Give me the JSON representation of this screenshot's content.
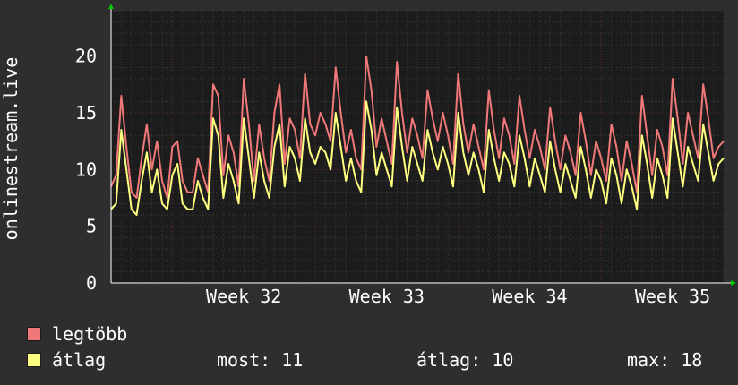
{
  "chart_data": {
    "type": "line",
    "ylabel": "onlinestream.live",
    "ylim": [
      0,
      24
    ],
    "yticks": [
      0,
      5,
      10,
      15,
      20
    ],
    "grid": true,
    "background": "#1c1c1c",
    "grid_major_color": "#5a2a2a",
    "grid_minor_color": "#3a3a3a",
    "axis_color": "#ffffff",
    "arrow_color": "#00c800",
    "x_week_labels": [
      "Week 32",
      "Week 33",
      "Week 34",
      "Week 35"
    ],
    "x": [
      0.0,
      0.25,
      0.5,
      0.75,
      1.0,
      1.25,
      1.5,
      1.75,
      2.0,
      2.25,
      2.5,
      2.75,
      3.0,
      3.25,
      3.5,
      3.75,
      4.0,
      4.25,
      4.5,
      4.75,
      5.0,
      5.25,
      5.5,
      5.75,
      6.0,
      6.25,
      6.5,
      6.75,
      7.0,
      7.25,
      7.5,
      7.75,
      8.0,
      8.25,
      8.5,
      8.75,
      9.0,
      9.25,
      9.5,
      9.75,
      10.0,
      10.25,
      10.5,
      10.75,
      11.0,
      11.25,
      11.5,
      11.75,
      12.0,
      12.25,
      12.5,
      12.75,
      13.0,
      13.25,
      13.5,
      13.75,
      14.0,
      14.25,
      14.5,
      14.75,
      15.0,
      15.25,
      15.5,
      15.75,
      16.0,
      16.25,
      16.5,
      16.75,
      17.0,
      17.25,
      17.5,
      17.75,
      18.0,
      18.25,
      18.5,
      18.75,
      19.0,
      19.25,
      19.5,
      19.75,
      20.0,
      20.25,
      20.5,
      20.75,
      21.0,
      21.25,
      21.5,
      21.75,
      22.0,
      22.25,
      22.5,
      22.75,
      23.0,
      23.25,
      23.5,
      23.75,
      24.0,
      24.25,
      24.5,
      24.75,
      25.0,
      25.25,
      25.5,
      25.75,
      26.0,
      26.25,
      26.5,
      26.75,
      27.0,
      27.25,
      27.5,
      27.75,
      28.0,
      28.25,
      28.5,
      28.75,
      29.0,
      29.25,
      29.5,
      29.75,
      30.0
    ],
    "series": [
      {
        "name": "legtöbb",
        "color": "#f07878",
        "values": [
          8.5,
          9.5,
          16.5,
          12.0,
          8.0,
          7.5,
          11.0,
          14.0,
          10.0,
          12.5,
          9.0,
          7.5,
          12.0,
          12.5,
          9.0,
          8.0,
          8.0,
          11.0,
          9.5,
          8.0,
          17.5,
          16.5,
          9.5,
          13.0,
          11.5,
          8.5,
          18.0,
          14.0,
          9.0,
          14.0,
          11.0,
          9.0,
          15.0,
          17.5,
          10.5,
          14.5,
          13.5,
          11.0,
          18.5,
          14.0,
          13.0,
          15.0,
          14.0,
          12.5,
          19.0,
          15.0,
          11.5,
          13.5,
          11.0,
          10.0,
          20.0,
          17.0,
          12.0,
          14.5,
          12.5,
          10.5,
          19.5,
          15.0,
          11.5,
          14.5,
          13.0,
          11.0,
          17.0,
          14.5,
          12.5,
          15.0,
          13.0,
          10.5,
          18.5,
          14.0,
          11.5,
          14.0,
          12.0,
          10.0,
          17.0,
          13.5,
          11.0,
          14.5,
          13.0,
          10.5,
          16.5,
          13.5,
          11.0,
          13.5,
          12.0,
          10.0,
          15.5,
          12.5,
          10.0,
          13.0,
          11.5,
          9.5,
          15.0,
          12.5,
          9.5,
          12.5,
          11.0,
          9.0,
          14.0,
          12.0,
          9.0,
          12.5,
          10.5,
          8.0,
          16.5,
          13.0,
          9.5,
          13.5,
          12.0,
          9.5,
          18.0,
          14.5,
          10.5,
          15.0,
          13.0,
          11.0,
          17.5,
          14.5,
          11.0,
          12.0,
          12.5
        ]
      },
      {
        "name": "átlag",
        "color": "#ffff80",
        "values": [
          6.5,
          7.0,
          13.5,
          10.0,
          6.5,
          6.0,
          9.0,
          11.5,
          8.0,
          10.0,
          7.0,
          6.5,
          9.5,
          10.5,
          7.0,
          6.5,
          6.5,
          9.0,
          7.5,
          6.5,
          14.5,
          13.0,
          7.5,
          10.5,
          9.0,
          7.0,
          14.5,
          11.0,
          7.5,
          11.5,
          9.0,
          7.5,
          12.0,
          14.0,
          8.5,
          12.0,
          11.0,
          9.0,
          14.5,
          11.5,
          10.5,
          12.0,
          11.5,
          10.0,
          15.0,
          12.0,
          9.0,
          11.0,
          9.0,
          8.0,
          16.0,
          13.5,
          9.5,
          11.5,
          10.0,
          8.5,
          15.5,
          12.0,
          9.0,
          12.0,
          10.5,
          9.0,
          13.5,
          11.5,
          10.0,
          12.0,
          10.5,
          8.5,
          15.0,
          11.5,
          9.5,
          11.5,
          10.0,
          8.0,
          13.5,
          11.0,
          9.0,
          11.5,
          10.5,
          8.5,
          13.0,
          11.0,
          8.5,
          11.0,
          9.5,
          8.0,
          12.5,
          10.0,
          8.0,
          10.5,
          9.0,
          7.5,
          12.0,
          10.0,
          7.5,
          10.0,
          9.0,
          7.0,
          11.0,
          9.5,
          7.0,
          10.0,
          8.5,
          6.5,
          13.0,
          10.5,
          7.5,
          11.0,
          9.5,
          7.5,
          14.5,
          11.5,
          8.5,
          12.0,
          10.5,
          9.0,
          14.0,
          11.5,
          9.0,
          10.5,
          11.0
        ]
      }
    ]
  },
  "legend": [
    {
      "label": "legtöbb",
      "color": "#f07878"
    },
    {
      "label": "átlag",
      "color": "#ffff80"
    }
  ],
  "stats": {
    "most": "most: 11",
    "atlag": "átlag: 10",
    "max": "max: 18"
  }
}
